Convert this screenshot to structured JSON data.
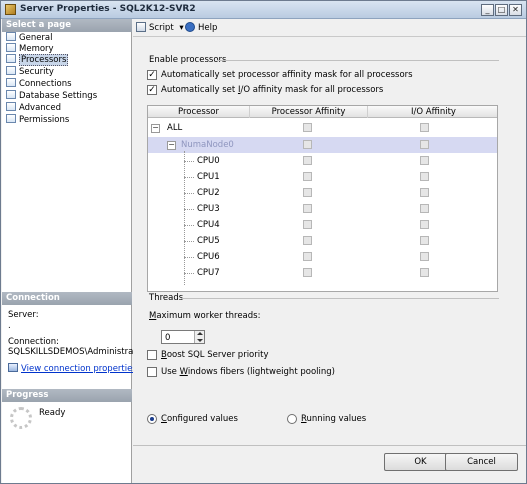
{
  "window": {
    "title": "Server Properties - SQL2K12-SVR2",
    "minimize_glyph": "_",
    "maximize_glyph": "□",
    "close_glyph": "✕"
  },
  "left_pane": {
    "select_page_header": "Select a page",
    "pages": [
      {
        "label": "General"
      },
      {
        "label": "Memory"
      },
      {
        "label": "Processors"
      },
      {
        "label": "Security"
      },
      {
        "label": "Connections"
      },
      {
        "label": "Database Settings"
      },
      {
        "label": "Advanced"
      },
      {
        "label": "Permissions"
      }
    ],
    "selected_page": "Processors",
    "connection_header": "Connection",
    "server_label": "Server:",
    "server_value": ".",
    "connection_label": "Connection:",
    "connection_value": "SQLSKILLSDEMOS\\Administrator",
    "view_connection_link": "View connection properties",
    "progress_header": "Progress",
    "progress_status": "Ready"
  },
  "toolbar": {
    "script_label": "Script",
    "script_dropdown_glyph": "▾",
    "help_label": "Help"
  },
  "enable_processors": {
    "section_label": "Enable processors",
    "auto_affinity_mask_label": "Automatically set processor affinity mask for all processors",
    "auto_affinity_mask_checked": true,
    "auto_io_affinity_mask_label_pre": "Automatically set ",
    "auto_io_affinity_mask_label_access": "I",
    "auto_io_affinity_mask_label_post": "/O affinity mask for all processors",
    "auto_io_affinity_mask_checked": true,
    "check_glyph": "✓"
  },
  "processor_grid": {
    "columns": [
      "Processor",
      "Processor Affinity",
      "I/O Affinity"
    ],
    "all_label": "ALL",
    "collapse_glyph": "−",
    "numa_node_label": "NumaNode0",
    "cpus": [
      "CPU0",
      "CPU1",
      "CPU2",
      "CPU3",
      "CPU4",
      "CPU5",
      "CPU6",
      "CPU7"
    ]
  },
  "threads": {
    "section_label": "Threads",
    "max_worker_threads_access": "M",
    "max_worker_threads_rest": "aximum worker threads:",
    "max_worker_threads_value": "0",
    "boost_priority_access": "B",
    "boost_priority_rest": "oost SQL Server priority",
    "boost_priority_checked": false,
    "windows_fibers_pre": "Use ",
    "windows_fibers_access": "W",
    "windows_fibers_rest": "indows fibers (lightweight pooling)",
    "windows_fibers_checked": false
  },
  "values_mode": {
    "configured_access": "C",
    "configured_rest": "onfigured  values",
    "running_access": "R",
    "running_rest": "unning values",
    "selected": "configured"
  },
  "buttons": {
    "ok_label": "OK",
    "cancel_label": "Cancel"
  },
  "colors": {
    "title_bar": "#c6d5e8",
    "pane_header": "#a4acb7",
    "numa_row_highlight": "#d6d9f2",
    "link": "#0033cc"
  }
}
